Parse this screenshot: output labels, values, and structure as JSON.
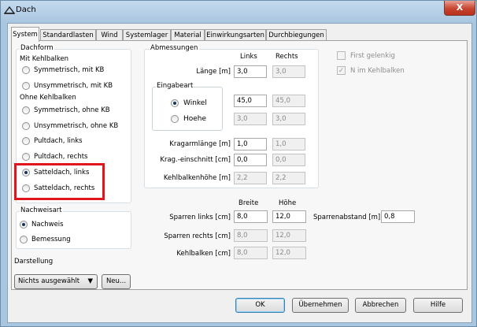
{
  "window": {
    "title": "Dach",
    "close_glyph": "X"
  },
  "tabs": [
    "System",
    "Standardlasten",
    "Wind",
    "Systemlager",
    "Material",
    "Einwirkungsarten",
    "Durchbiegungen"
  ],
  "dachform": {
    "title": "Dachform",
    "mit_label": "Mit Kehlbalken",
    "ohne_label": "Ohne Kehlbalken",
    "options": [
      "Symmetrisch, mit KB",
      "Unsymmetrisch, mit KB",
      "Symmetrisch, ohne KB",
      "Unsymmetrisch, ohne KB",
      "Pultdach, links",
      "Pultdach, rechts",
      "Satteldach, links",
      "Satteldach, rechts"
    ],
    "selected_index": 6
  },
  "nachweisart": {
    "title": "Nachweisart",
    "options": [
      "Nachweis",
      "Bemessung"
    ],
    "selected_index": 0
  },
  "darstellung": {
    "label": "Darstellung",
    "select_value": "Nichts ausgewählt",
    "new_button": "Neu..."
  },
  "abmessungen": {
    "title": "Abmessungen",
    "col_links": "Links",
    "col_rechts": "Rechts",
    "laenge": {
      "label": "Länge [m]",
      "links": "3,0",
      "rechts": "3,0"
    },
    "eingabeart": {
      "title": "Eingabeart",
      "winkel": "Winkel",
      "hoehe": "Hoehe",
      "selected": "winkel"
    },
    "winkel": {
      "links": "45,0",
      "rechts": "45,0"
    },
    "hoehe": {
      "links": "3,0",
      "rechts": "3,0"
    },
    "kragarm": {
      "label": "Kragarmlänge [m]",
      "links": "1,0",
      "rechts": "1,0"
    },
    "krag_einschnitt": {
      "label": "Krag.-einschnitt [cm]",
      "links": "0,0",
      "rechts": "0,0"
    },
    "kehlbalkenhoehe": {
      "label": "Kehlbalkenhöhe [m]",
      "links": "2,2",
      "rechts": "2,2"
    }
  },
  "checkboxes": {
    "first_gelenkig": "First gelenkig",
    "n_im_kehlbalken": "N im Kehlbalken"
  },
  "querschnitte": {
    "col_breite": "Breite",
    "col_hoehe": "Höhe",
    "sparren_links": {
      "label": "Sparren links [cm]",
      "breite": "8,0",
      "hoehe": "12,0"
    },
    "sparren_rechts": {
      "label": "Sparren rechts [cm]",
      "breite": "8,0",
      "hoehe": "12,0"
    },
    "kehlbalken": {
      "label": "Kehlbalken [cm]",
      "breite": "8,0",
      "hoehe": "12,0"
    },
    "sparrenabstand": {
      "label": "Sparrenabstand [m]",
      "value": "0,8"
    }
  },
  "buttons": {
    "ok": "OK",
    "uebernehmen": "Übernehmen",
    "abbrechen": "Abbrechen",
    "hilfe": "Hilfe"
  },
  "colors": {
    "highlight": "#e0151e",
    "titlebar": "#a9c6e0"
  }
}
